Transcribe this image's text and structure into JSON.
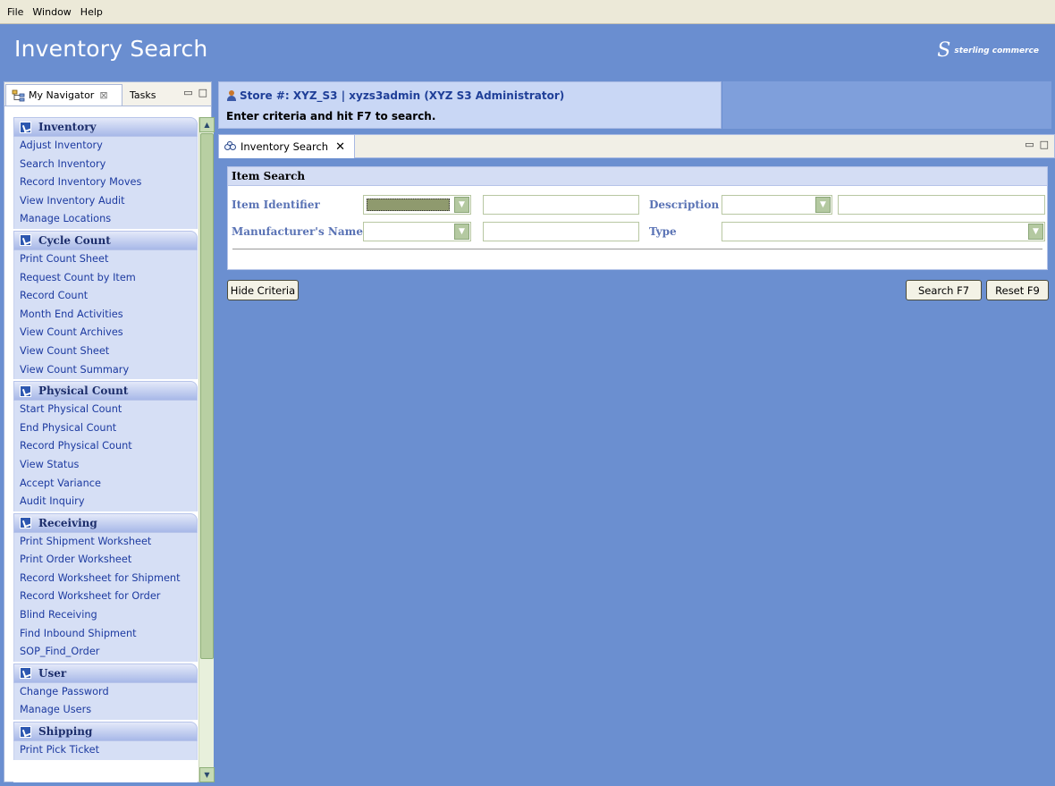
{
  "menu": {
    "file": "File",
    "window": "Window",
    "help": "Help"
  },
  "app": {
    "title": "Inventory Search",
    "brand_swirl": "S",
    "brand_name": "sterling commerce"
  },
  "navigator": {
    "tabs": {
      "my_navigator": "My Navigator",
      "tasks": "Tasks"
    },
    "close_glyph": "⊠",
    "sections": [
      {
        "title": "Inventory",
        "items": [
          "Adjust Inventory",
          "Search Inventory",
          "Record Inventory Moves",
          "View Inventory Audit",
          "Manage Locations"
        ]
      },
      {
        "title": "Cycle Count",
        "items": [
          "Print Count Sheet",
          "Request Count by Item",
          "Record Count",
          "Month End Activities",
          "View Count Archives",
          "View Count Sheet",
          "View Count Summary"
        ]
      },
      {
        "title": "Physical Count",
        "items": [
          "Start Physical Count",
          "End Physical Count",
          "Record Physical Count",
          "View Status",
          "Accept Variance",
          "Audit Inquiry"
        ]
      },
      {
        "title": "Receiving",
        "items": [
          "Print Shipment Worksheet",
          "Print Order Worksheet",
          "Record Worksheet for Shipment",
          "Record Worksheet for Order",
          "Blind Receiving",
          "Find Inbound Shipment",
          "SOP_Find_Order"
        ]
      },
      {
        "title": "User",
        "items": [
          "Change Password",
          "Manage Users"
        ]
      },
      {
        "title": "Shipping",
        "items": [
          "Print Pick Ticket"
        ]
      }
    ]
  },
  "context": {
    "store": "Store #: XYZ_S3 | xyzs3admin (XYZ S3 Administrator)",
    "hint": "Enter criteria and hit F7 to search."
  },
  "editor": {
    "tab_label": "Inventory Search",
    "tab_close": "✕",
    "panel_title": "Item Search",
    "fields": {
      "item_identifier": "Item Identifier",
      "description": "Description",
      "manufacturer": "Manufacturer's Name",
      "type": "Type"
    },
    "buttons": {
      "hide_criteria": "Hide Criteria",
      "search": "Search  F7",
      "reset": "Reset  F9"
    }
  },
  "colors": {
    "background": "#6b8fd0",
    "header": "#6a8ed0",
    "section_header": "#a7b8e8",
    "link": "#1c3aa0"
  },
  "icons": {
    "navigator": "navigator-tree-icon",
    "section": "section-check-icon",
    "user": "user-icon",
    "tab": "binoculars-icon",
    "dropdown": "chevron-down-icon"
  }
}
